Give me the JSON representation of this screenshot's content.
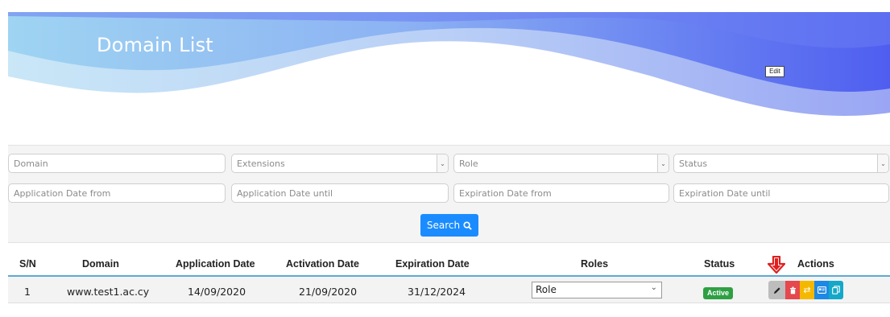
{
  "header": {
    "title": "Domain List"
  },
  "filters": {
    "domain_placeholder": "Domain",
    "extensions_value": "Extensions",
    "role_value": "Role",
    "status_value": "Status",
    "app_from_placeholder": "Application Date from",
    "app_until_placeholder": "Application Date until",
    "exp_from_placeholder": "Expiration Date from",
    "exp_until_placeholder": "Expiration Date until",
    "search_label": "Search"
  },
  "table": {
    "columns": [
      "S/N",
      "Domain",
      "Application Date",
      "Activation Date",
      "Expiration Date",
      "Roles",
      "Status",
      "Actions"
    ],
    "rows": [
      {
        "sn": "1",
        "domain": "www.test1.ac.cy",
        "application_date": "14/09/2020",
        "activation_date": "21/09/2020",
        "expiration_date": "31/12/2024",
        "role": "Role",
        "status": "Active"
      }
    ]
  },
  "tooltip": "Edit",
  "icons": {
    "search": "search-icon",
    "edit": "pencil-icon",
    "delete": "trash-icon",
    "transfer": "swap-icon",
    "details": "id-card-icon",
    "copy": "copy-icon",
    "annotation": "red-down-arrow-icon"
  },
  "colors": {
    "header_wave": "#4f6bf0",
    "search_button": "#1a8cff",
    "active_badge": "#2ea043",
    "delete": "#e5484d",
    "transfer": "#f5b800",
    "details": "#1e88e5",
    "copy": "#14a8c8",
    "arrow": "#e02020"
  }
}
